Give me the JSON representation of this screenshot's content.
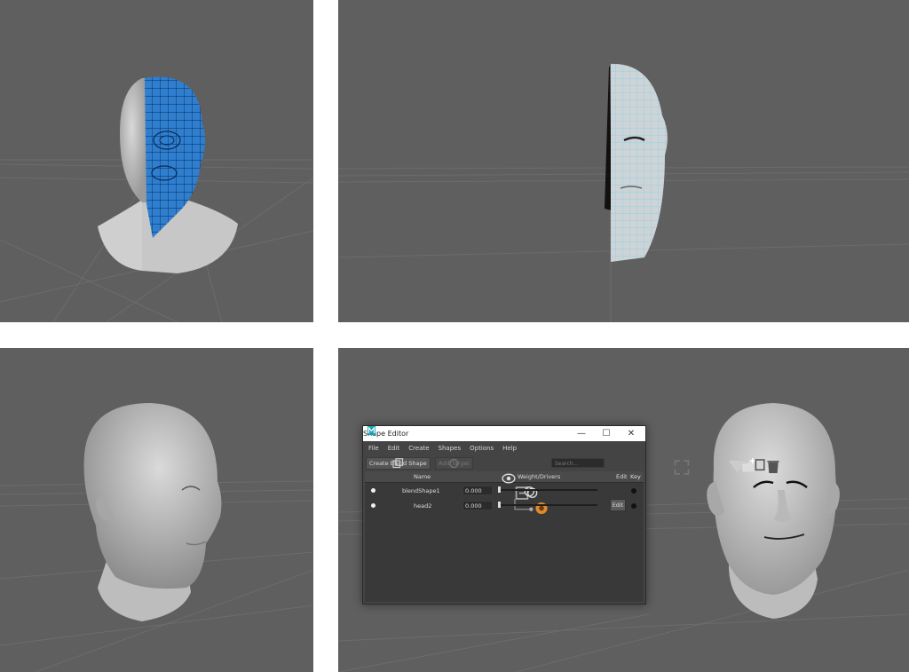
{
  "shape_editor": {
    "title": "Shape Editor",
    "window_controls": {
      "minimize": "—",
      "maximize": "☐",
      "close": "✕"
    },
    "menu": [
      "File",
      "Edit",
      "Create",
      "Shapes",
      "Options",
      "Help"
    ],
    "toolbar": {
      "create_blend_shape": "Create Blend Shape",
      "add_target": "Add Target",
      "search_placeholder": "Search..."
    },
    "columns": {
      "name": "Name",
      "weight": "Weight/Drivers",
      "edit": "Edit",
      "key": "Key"
    },
    "rows": [
      {
        "name": "blendShape1",
        "value": "0.000"
      },
      {
        "name": "head2",
        "value": "0.000",
        "edit": "Edit"
      }
    ]
  },
  "colors": {
    "viewport_bg": "#5f5f5f",
    "wire_blue": "#2f7fd0",
    "wire_cyan": "#6fd6f4",
    "head_gray": "#c8c8c8"
  }
}
